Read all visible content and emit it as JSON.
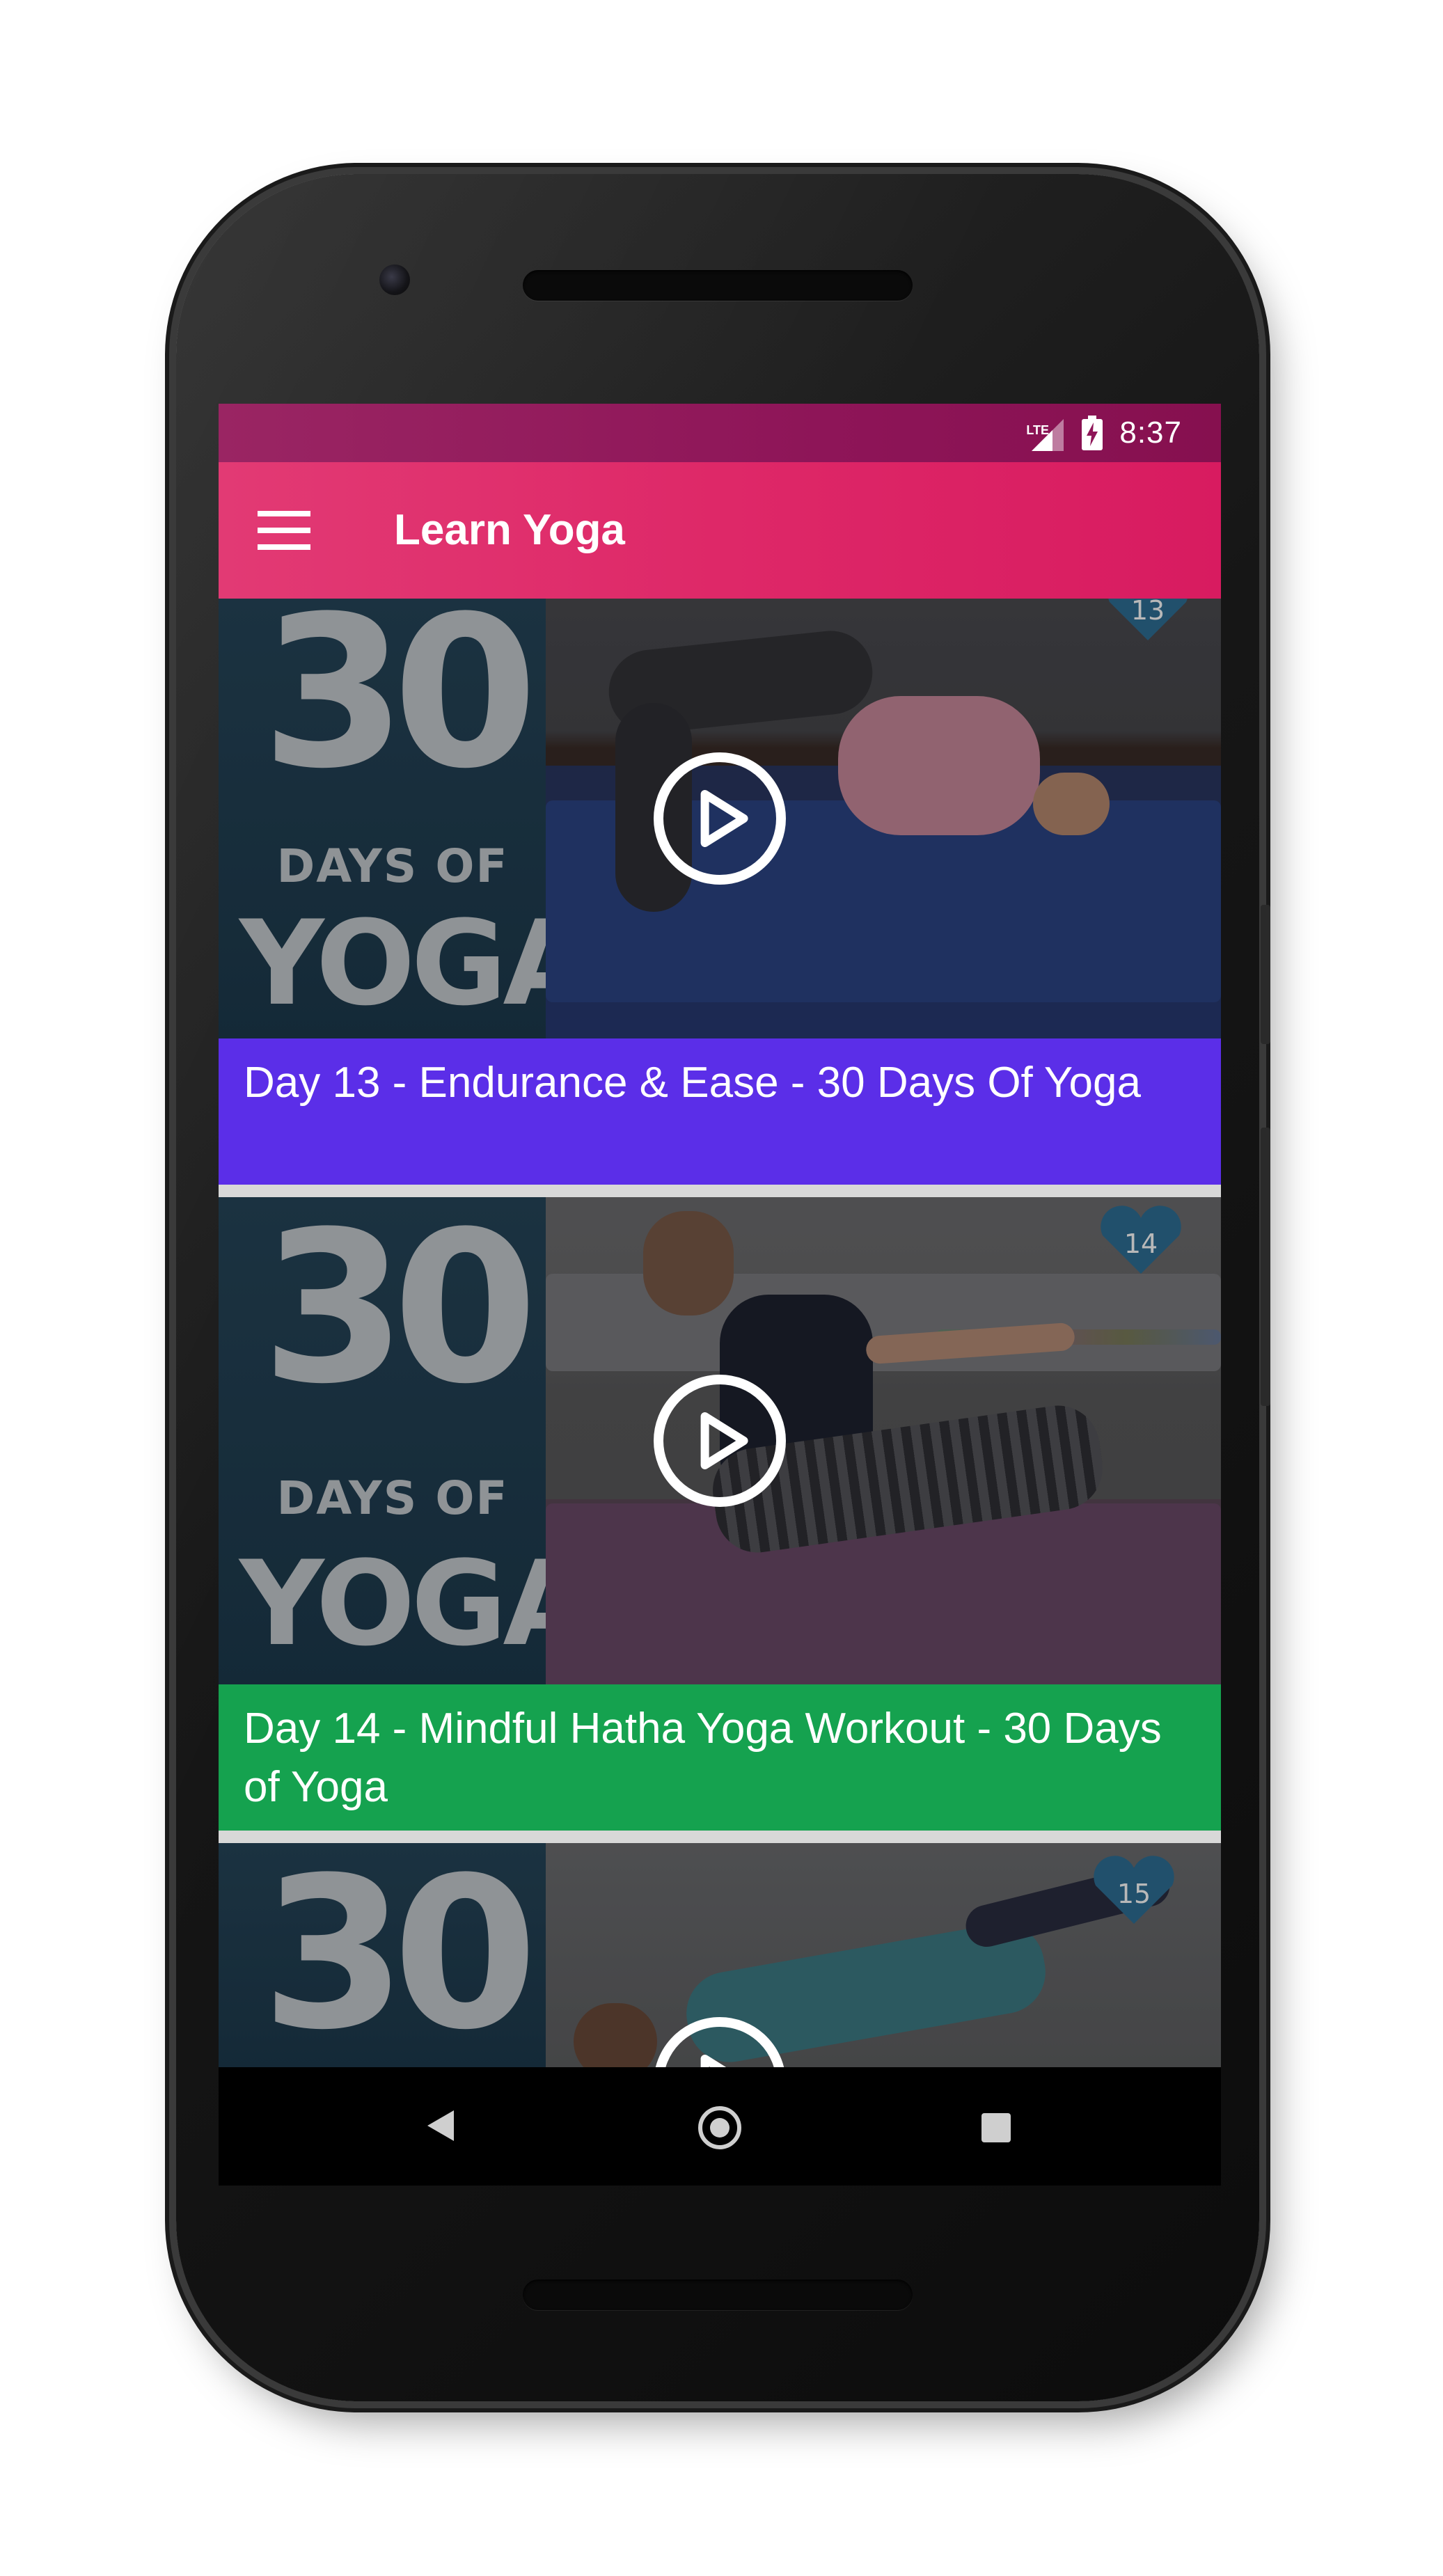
{
  "status_bar": {
    "network_label": "LTE",
    "time": "8:37",
    "icons": [
      "lte-signal-icon",
      "battery-charging-icon"
    ]
  },
  "app_bar": {
    "title": "Learn Yoga",
    "menu_icon": "hamburger-menu-icon"
  },
  "videos": [
    {
      "title": "Day 13 - Endurance & Ease - 30 Days Of Yoga",
      "poster_number": "30",
      "poster_days": "DAYS OF",
      "poster_yoga": "YOGA",
      "badge_number": "13",
      "band_color": "#5b2ee8"
    },
    {
      "title": "Day 14 - Mindful Hatha Yoga Workout - 30 Days of Yoga",
      "poster_number": "30",
      "poster_days": "DAYS OF",
      "poster_yoga": "YOGA",
      "badge_number": "14",
      "band_color": "#15a24f"
    },
    {
      "title": "",
      "poster_number": "30",
      "badge_number": "15"
    }
  ],
  "nav_bar": {
    "icons": [
      "back-icon",
      "home-icon",
      "recents-icon"
    ]
  },
  "colors": {
    "status_bar": "#8e1558",
    "app_bar": "#d81b60",
    "accent_purple": "#5b2ee8",
    "accent_green": "#15a24f"
  }
}
